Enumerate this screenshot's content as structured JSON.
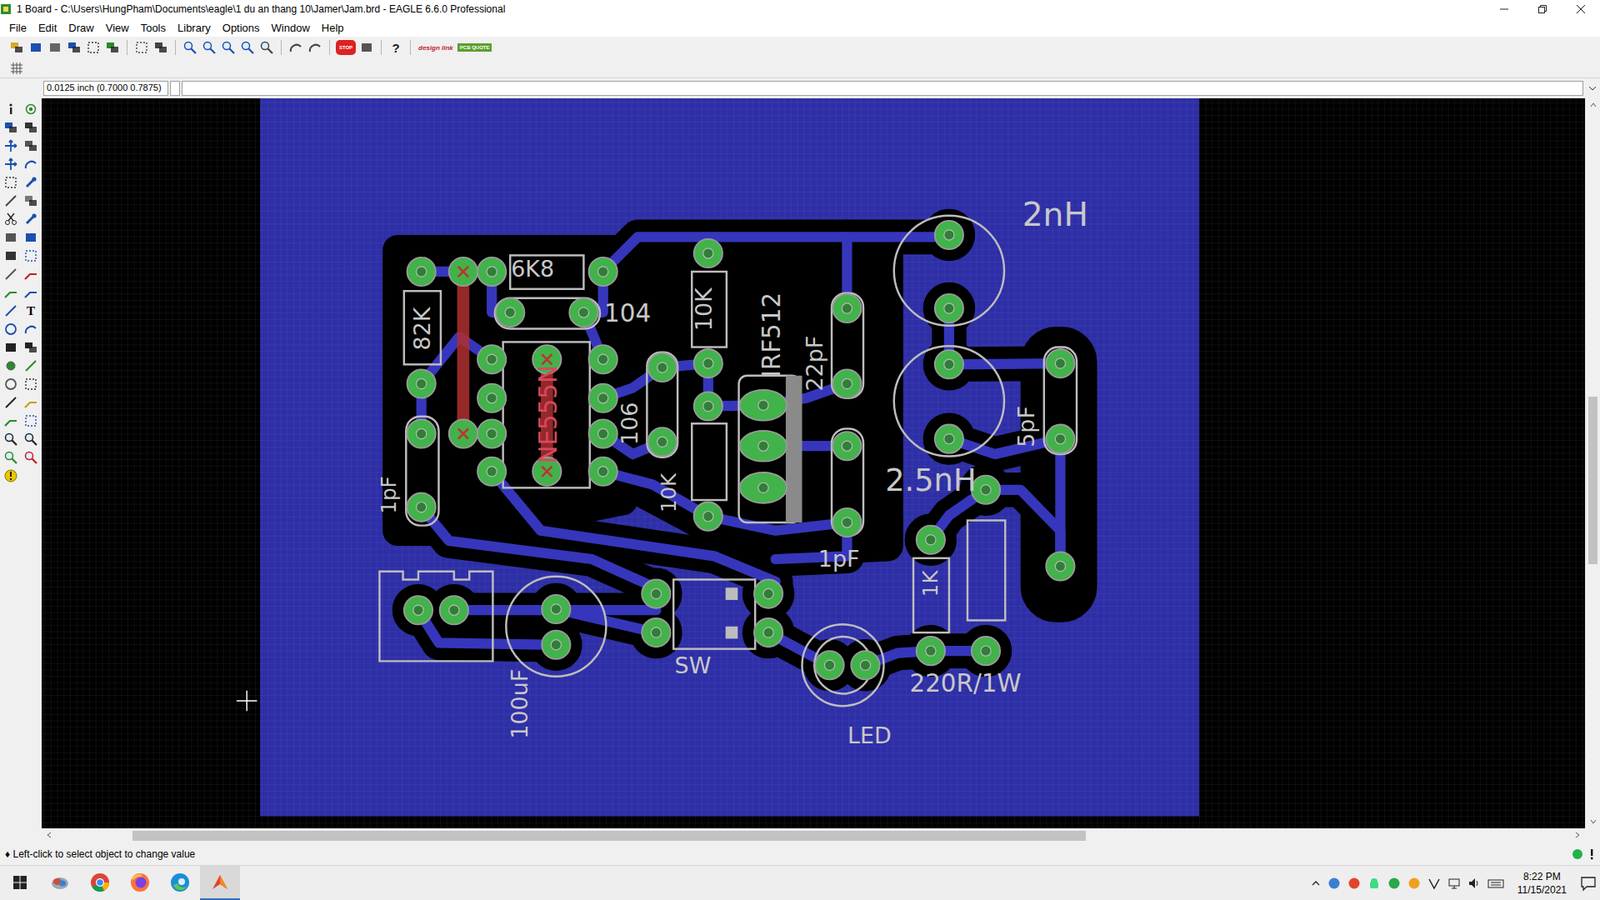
{
  "window": {
    "title": "1 Board - C:\\Users\\HungPham\\Documents\\eagle\\1 du an thang 10\\Jamer\\Jam.brd - EAGLE 6.6.0 Professional"
  },
  "menu": [
    "File",
    "Edit",
    "Draw",
    "View",
    "Tools",
    "Library",
    "Options",
    "Window",
    "Help"
  ],
  "toolbar": {
    "stop_label": "STOP",
    "help_label": "?",
    "design_link_label": "design link",
    "pcb_quote_label": "PCB QUOTE"
  },
  "palette": {
    "text_tool_label": "T"
  },
  "command_line": {
    "coordinates": "0.0125 inch (0.7000 0.7875)",
    "value": ""
  },
  "board": {
    "labels": [
      {
        "text": "2nH",
        "color": "#c8c8c8"
      },
      {
        "text": "6K8",
        "color": "#c8c8c8"
      },
      {
        "text": "104",
        "color": "#c8c8c8"
      },
      {
        "text": "82K",
        "color": "#c8c8c8"
      },
      {
        "text": "NE555N",
        "color": "#d9485f"
      },
      {
        "text": "10K",
        "color": "#c8c8c8"
      },
      {
        "text": "IRF512",
        "color": "#c8c8c8"
      },
      {
        "text": "22pF",
        "color": "#c8c8c8"
      },
      {
        "text": "106",
        "color": "#c8c8c8"
      },
      {
        "text": "5pF",
        "color": "#c8c8c8"
      },
      {
        "text": "2.5nH",
        "color": "#c8c8c8"
      },
      {
        "text": "1pF",
        "color": "#c8c8c8"
      },
      {
        "text": "10K",
        "color": "#c8c8c8"
      },
      {
        "text": "1pF",
        "color": "#c8c8c8"
      },
      {
        "text": "1K",
        "color": "#c8c8c8"
      },
      {
        "text": "SW",
        "color": "#c8c8c8"
      },
      {
        "text": "100uF",
        "color": "#c8c8c8"
      },
      {
        "text": "220R/1W",
        "color": "#c8c8c8"
      },
      {
        "text": "LED",
        "color": "#c8c8c8"
      }
    ]
  },
  "scrollbars": {
    "horizontal": {
      "start": 0.05,
      "size": 0.63
    },
    "vertical": {
      "start": 0.39,
      "size": 0.23
    }
  },
  "status_bar": {
    "hint": "♦ Left-click to select object to change value"
  },
  "taskbar": {
    "apps": [
      {
        "kind": "photos",
        "selected": false
      },
      {
        "kind": "chrome",
        "selected": false
      },
      {
        "kind": "firefox",
        "selected": false
      },
      {
        "kind": "edge",
        "selected": false
      },
      {
        "kind": "eagle",
        "selected": true
      }
    ],
    "time": "8:22 PM",
    "date": "11/15/2021"
  }
}
